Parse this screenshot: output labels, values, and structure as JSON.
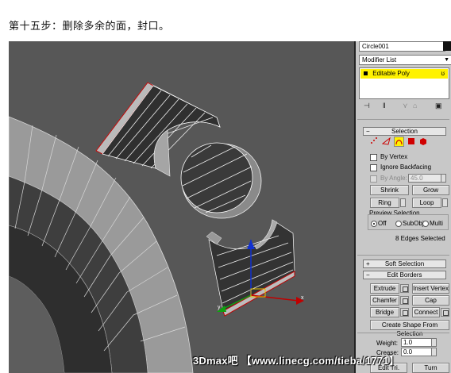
{
  "caption": "第十五步：删除多余的面，封口。",
  "panel": {
    "object_name": "Circle001",
    "modifier_list": "Modifier List",
    "stack_item": "Editable Poly",
    "selection": {
      "title": "Selection",
      "by_vertex": "By Vertex",
      "ignore_backfacing": "Ignore Backfacing",
      "by_angle_label": "By Angle:",
      "by_angle_value": "45.0",
      "shrink": "Shrink",
      "grow": "Grow",
      "ring": "Ring",
      "loop": "Loop",
      "preview_title": "Preview Selection",
      "preview_off": "Off",
      "preview_subobj": "SubObj",
      "preview_multi": "Multi",
      "status": "8 Edges Selected"
    },
    "soft_selection": "Soft Selection",
    "edit_borders": {
      "title": "Edit Borders",
      "extrude": "Extrude",
      "insert_vertex": "Insert Vertex",
      "chamfer": "Chamfer",
      "cap": "Cap",
      "bridge": "Bridge",
      "connect": "Connect",
      "create_shape": "Create Shape From Selection",
      "weight_label": "Weight:",
      "weight_value": "1.0",
      "crease_label": "Crease:",
      "crease_value": "0.0",
      "edit_tri": "Edit Tri.",
      "turn": "Turn"
    }
  },
  "viewport": {
    "gizmo_x": "x",
    "gizmo_y": "y"
  },
  "watermark": "3Dmax吧 【www.linecg.com/tieba/1771】",
  "colors": {
    "viewport_bg": "#575757",
    "panel_bg": "#c8c8c8",
    "highlight": "#fff200",
    "selected_edge": "#d40000"
  }
}
